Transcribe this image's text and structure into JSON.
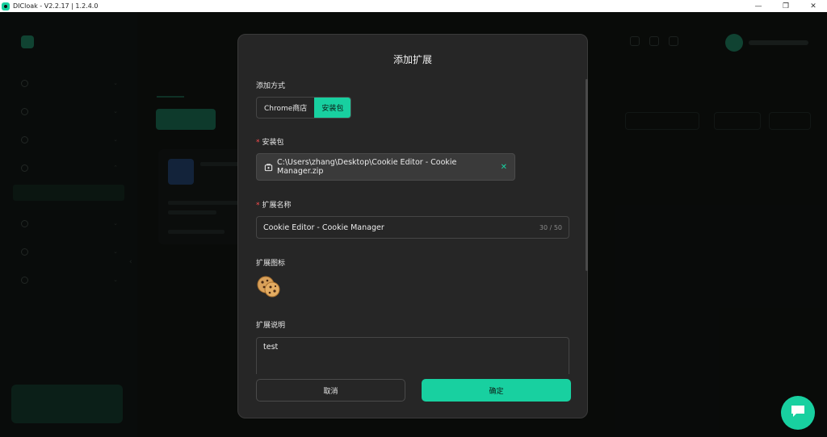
{
  "window": {
    "title": "DICloak - V2.2.17 | 1.2.4.0",
    "controls": {
      "minimize": "—",
      "maximize": "❐",
      "close": "✕"
    }
  },
  "colors": {
    "accent": "#18d0a0",
    "danger": "#ff4d4f",
    "modal_bg": "#262626"
  },
  "modal": {
    "title": "添加扩展",
    "method": {
      "label": "添加方式",
      "options": [
        {
          "label": "Chrome商店",
          "selected": false
        },
        {
          "label": "安装包",
          "selected": true
        }
      ]
    },
    "package": {
      "required_mark": "*",
      "label": "安装包",
      "file_path": "C:\\Users\\zhang\\Desktop\\Cookie Editor - Cookie Manager.zip",
      "remove_icon": "✕"
    },
    "name": {
      "required_mark": "*",
      "label": "扩展名称",
      "value": "Cookie Editor - Cookie Manager",
      "counter": "30 / 50"
    },
    "icon": {
      "label": "扩展图标",
      "icon_name": "cookie-icon"
    },
    "description": {
      "label": "扩展说明",
      "value": "test"
    },
    "buttons": {
      "cancel": "取消",
      "confirm": "确定"
    }
  },
  "chat": {
    "icon_name": "chat-bubble-icon"
  }
}
